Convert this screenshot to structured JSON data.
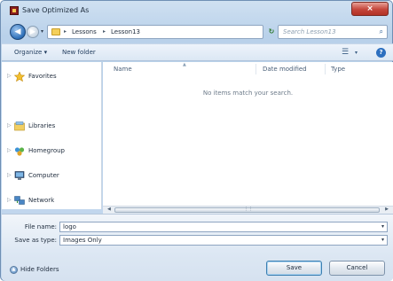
{
  "window": {
    "title": "Save Optimized As",
    "close_glyph": "×"
  },
  "address_bar": {
    "breadcrumbs": [
      "Lessons",
      "Lesson13"
    ],
    "separator": "▸",
    "search_placeholder": "Search Lesson13"
  },
  "toolbar": {
    "organize": "Organize ▾",
    "new_folder": "New folder"
  },
  "nav_pane": {
    "items": [
      {
        "label": "Favorites",
        "icon": "star-icon"
      },
      {
        "label": "Libraries",
        "icon": "libraries-icon"
      },
      {
        "label": "Homegroup",
        "icon": "homegroup-icon"
      },
      {
        "label": "Computer",
        "icon": "computer-icon"
      },
      {
        "label": "Network",
        "icon": "network-icon"
      }
    ]
  },
  "file_list": {
    "columns": [
      "Name",
      "Date modified",
      "Type"
    ],
    "empty_message": "No items match your search."
  },
  "form": {
    "file_name_label": "File name:",
    "file_name_value": "logo",
    "save_as_type_label": "Save as type:",
    "save_as_type_value": "Images Only"
  },
  "footer": {
    "hide_folders": "Hide Folders",
    "save": "Save",
    "cancel": "Cancel"
  }
}
